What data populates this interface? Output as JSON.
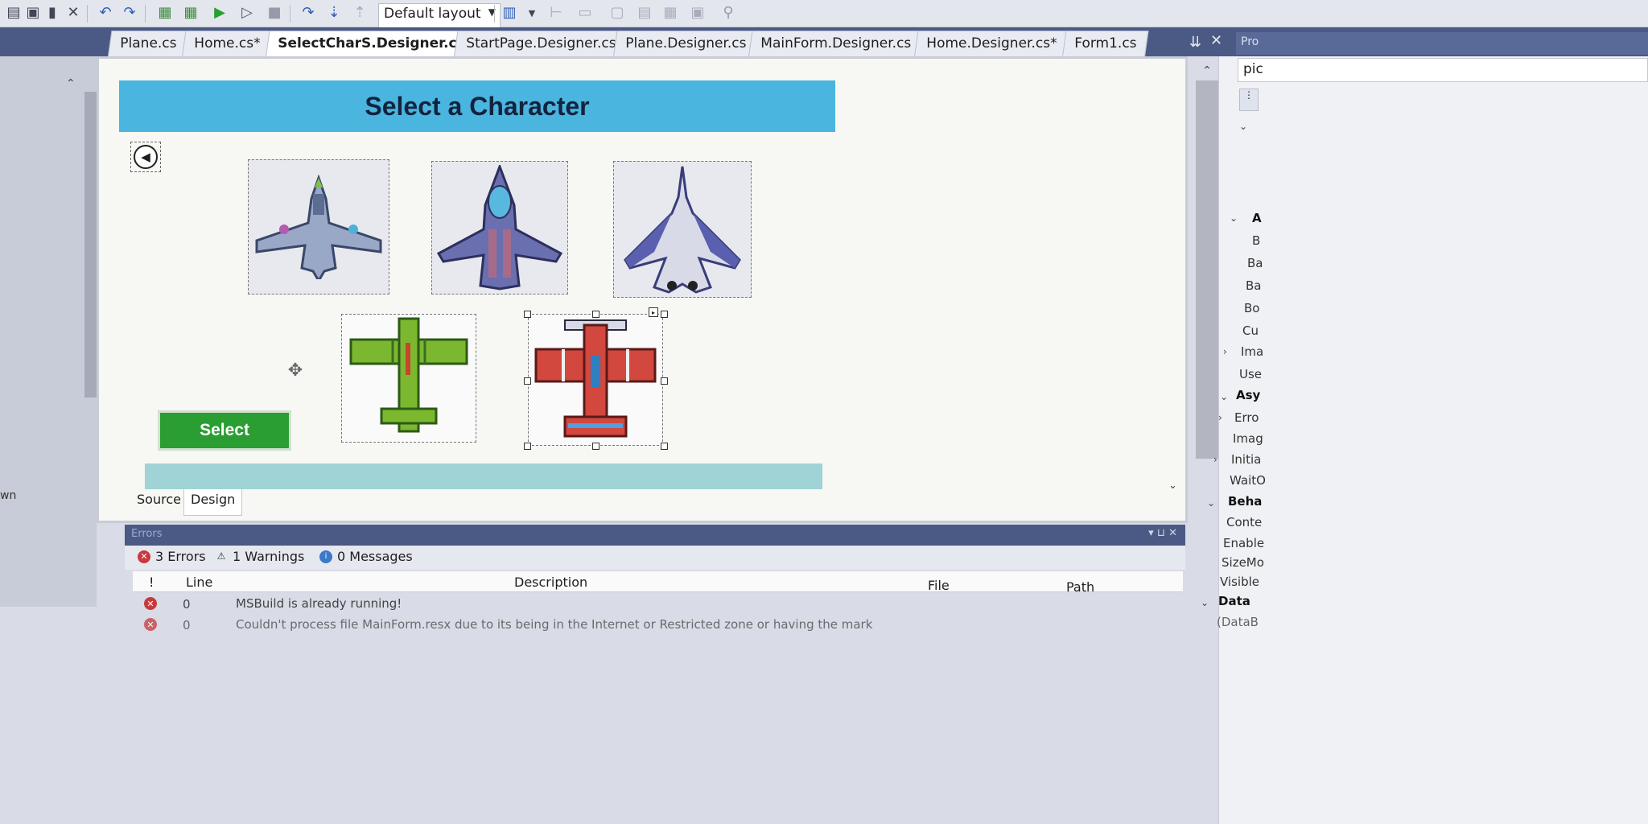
{
  "toolbar": {
    "layout_label": "Default layout"
  },
  "tabs": [
    {
      "label": "Plane.cs"
    },
    {
      "label": "Home.cs*"
    },
    {
      "label": "SelectCharS.Designer.cs"
    },
    {
      "label": "StartPage.Designer.cs"
    },
    {
      "label": "Plane.Designer.cs"
    },
    {
      "label": "MainForm.Designer.cs"
    },
    {
      "label": "Home.Designer.cs*"
    },
    {
      "label": "Form1.cs"
    }
  ],
  "left_pane": {
    "frag1": "wn"
  },
  "form": {
    "title": "Select a Character",
    "select_label": "Select",
    "back_icon": "arrow-left-icon",
    "move_icon": "move-icon"
  },
  "planes": [
    {
      "name": "gray-fighter-jet",
      "color": "#9aa8c8"
    },
    {
      "name": "purple-stealth-jet",
      "color": "#6a6fb0"
    },
    {
      "name": "white-eagle-jet",
      "color": "#d8dae8"
    },
    {
      "name": "green-propeller-plane",
      "color": "#7cb82f"
    },
    {
      "name": "red-propeller-plane",
      "color": "#d2473e"
    }
  ],
  "view_tabs": {
    "source": "Source",
    "design": "Design"
  },
  "error_list": {
    "title": "Errors",
    "errors": "3 Errors",
    "warnings": "1 Warnings",
    "messages": "0 Messages",
    "columns": {
      "flag": "!",
      "line": "Line",
      "description": "Description",
      "file": "File",
      "path": "Path"
    },
    "rows": [
      {
        "line": "0",
        "description": "MSBuild is already running!"
      },
      {
        "line": "0",
        "description": "Couldn't process file MainForm.resx due to its being in the Internet or Restricted zone or having the mark"
      }
    ]
  },
  "properties": {
    "search": "pic",
    "items": [
      {
        "label": "A",
        "type": "cat"
      },
      {
        "label": "B"
      },
      {
        "label": "Ba"
      },
      {
        "label": "Ba"
      },
      {
        "label": "Bo"
      },
      {
        "label": "Cu"
      },
      {
        "label": "Ima"
      },
      {
        "label": "Use"
      },
      {
        "label": "Asy",
        "type": "cat"
      },
      {
        "label": "Erro"
      },
      {
        "label": "Imag"
      },
      {
        "label": "Initia"
      },
      {
        "label": "WaitO"
      },
      {
        "label": "Beha",
        "type": "cat"
      },
      {
        "label": "Conte"
      },
      {
        "label": "Enable"
      },
      {
        "label": "SizeMo"
      },
      {
        "label": "Visible"
      },
      {
        "label": "Data",
        "type": "cat"
      },
      {
        "label": "(DataB"
      }
    ]
  },
  "colors": {
    "banner": "#4ab5df",
    "select_button": "#2a9d33",
    "footer_bar": "#9fd3d6",
    "tab_strip": "#4b5a84",
    "error_icon": "#c9383a"
  }
}
